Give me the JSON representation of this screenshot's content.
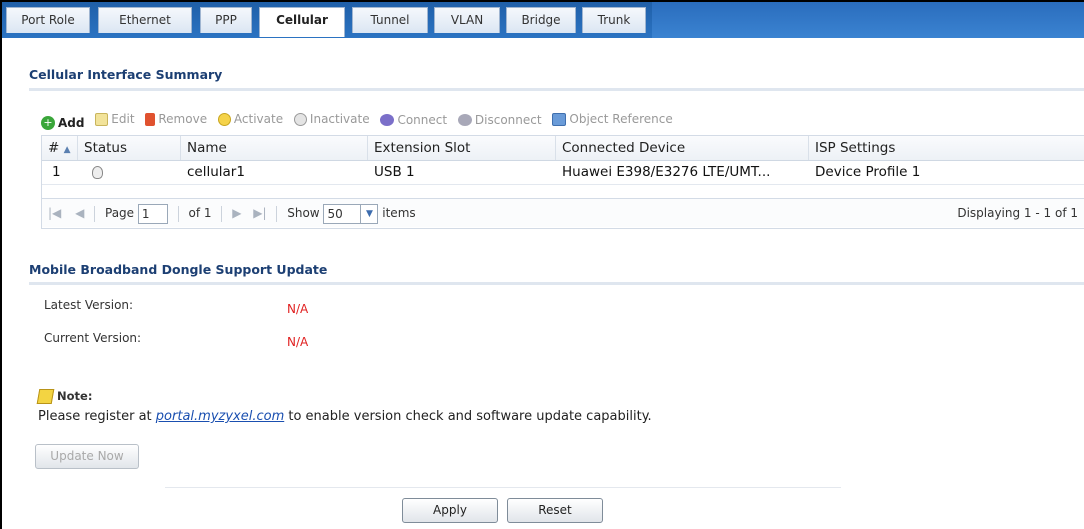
{
  "tabs": [
    "Port Role",
    "Ethernet",
    "PPP",
    "Cellular",
    "Tunnel",
    "VLAN",
    "Bridge",
    "Trunk"
  ],
  "active_tab": "Cellular",
  "summary": {
    "title": "Cellular Interface Summary",
    "toolbar": {
      "add": "Add",
      "edit": "Edit",
      "remove": "Remove",
      "activate": "Activate",
      "inactivate": "Inactivate",
      "connect": "Connect",
      "disconnect": "Disconnect",
      "object_reference": "Object Reference"
    },
    "columns": [
      "#",
      "Status",
      "Name",
      "Extension Slot",
      "Connected Device",
      "ISP Settings"
    ],
    "rows": [
      {
        "num": "1",
        "name": "cellular1",
        "slot": "USB 1",
        "device": "Huawei E398/E3276 LTE/UMT...",
        "isp": "Device Profile 1"
      }
    ],
    "pager": {
      "page_label": "Page",
      "page_value": "1",
      "of_label": "of 1",
      "show_label": "Show",
      "show_value": "50",
      "items_label": "items",
      "displaying": "Displaying 1 - 1 of 1"
    }
  },
  "dongle": {
    "title": "Mobile Broadband Dongle Support Update",
    "latest_label": "Latest Version:",
    "latest_value": "N/A",
    "current_label": "Current Version:",
    "current_value": "N/A",
    "note_label": "Note:",
    "note_prefix": "Please register at",
    "note_link": "portal.myzyxel.com",
    "note_suffix": "to enable version check and software update capability.",
    "update_button": "Update Now"
  },
  "buttons": {
    "apply": "Apply",
    "reset": "Reset"
  }
}
